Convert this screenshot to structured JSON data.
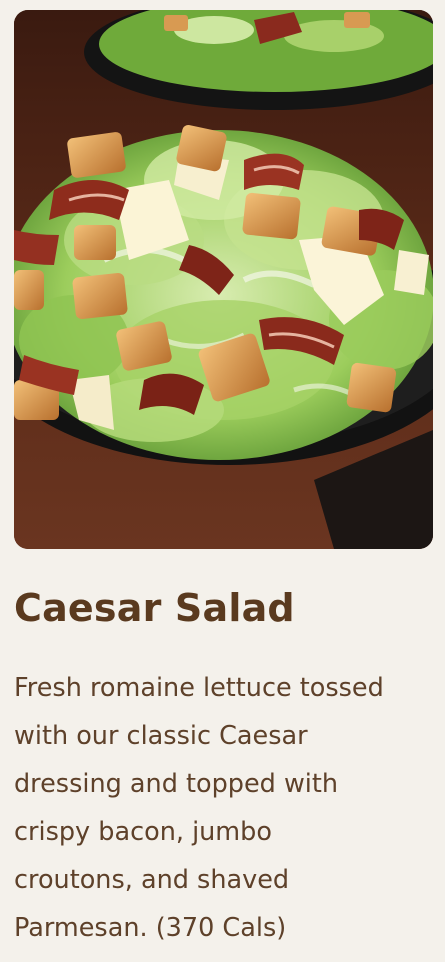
{
  "item": {
    "image_alt": "Caesar salad with romaine lettuce, croutons, bacon and shaved Parmesan on a dark plate",
    "title": "Caesar Salad",
    "description": "Fresh romaine lettuce tossed\nwith our classic Caesar\ndressing and topped with\ncrispy bacon, jumbo\ncroutons, and shaved\nParmesan.  (370 Cals)"
  }
}
